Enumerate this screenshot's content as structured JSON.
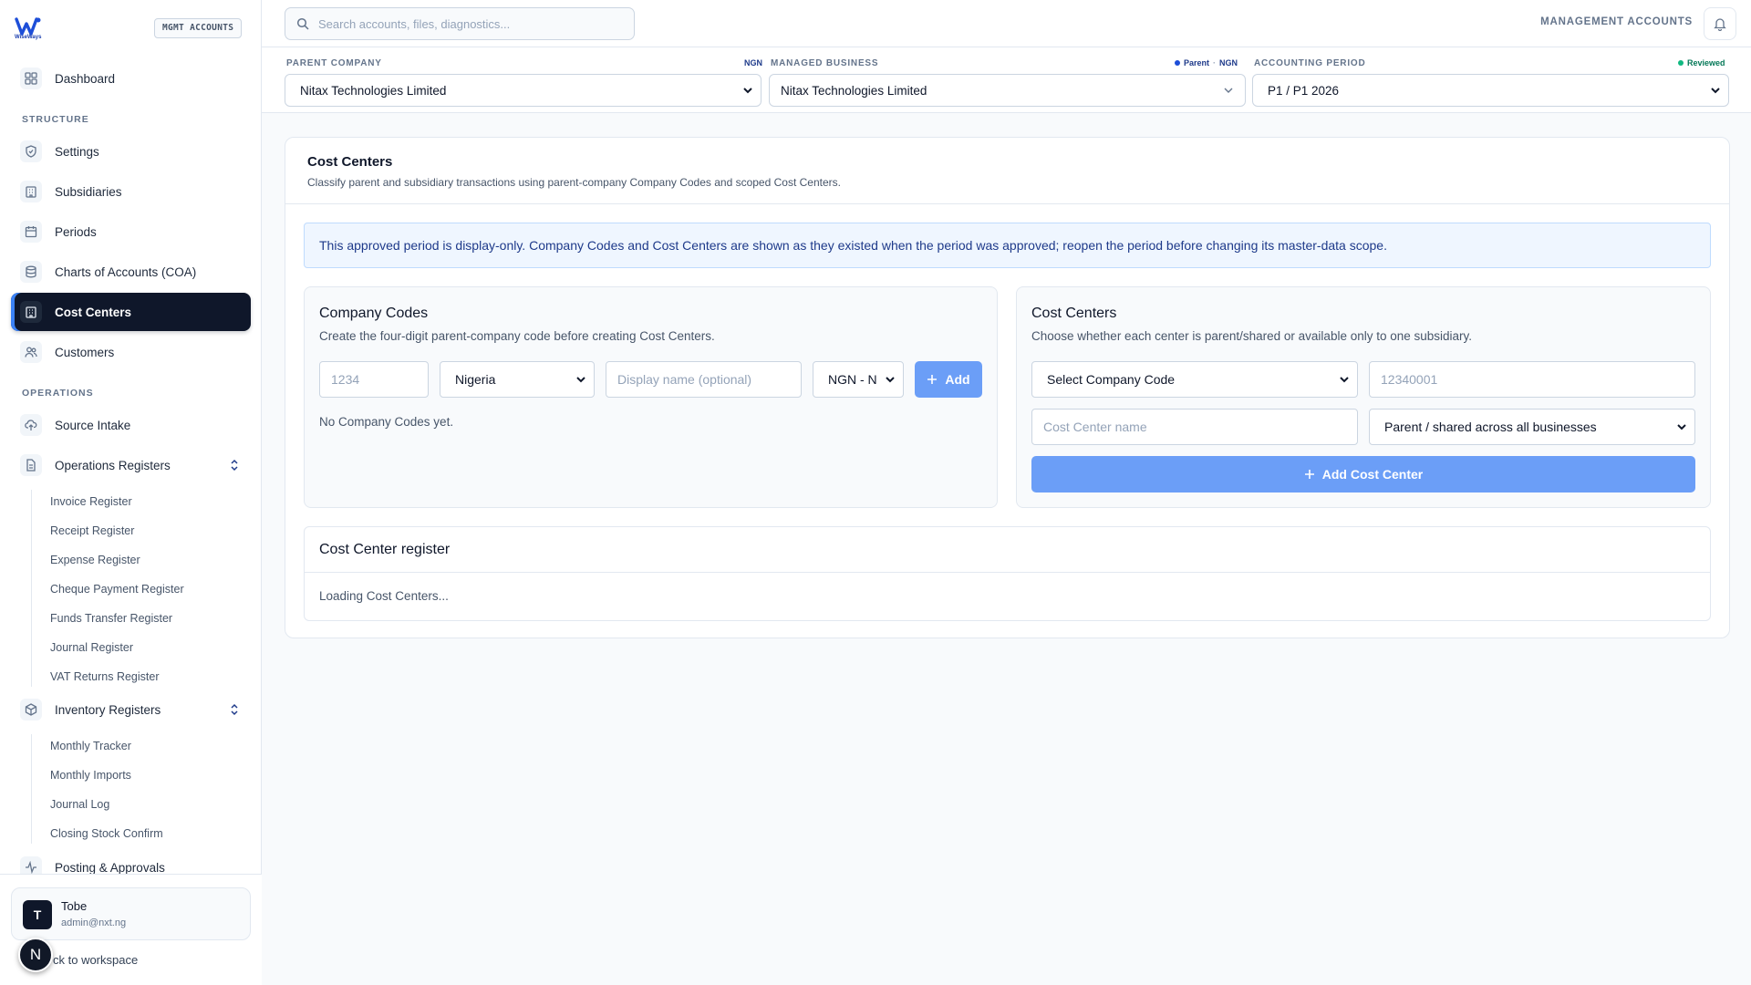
{
  "brand": {
    "badge": "MGMT ACCOUNTS",
    "logo_text": "WiseWays"
  },
  "search": {
    "placeholder": "Search accounts, files, diagnostics..."
  },
  "topbar": {
    "mode_label": "MANAGEMENT ACCOUNTS"
  },
  "sidebar": {
    "dashboard": "Dashboard",
    "structure_label": "STRUCTURE",
    "structure_items": [
      "Settings",
      "Subsidiaries",
      "Periods",
      "Charts of Accounts (COA)",
      "Cost Centers",
      "Customers"
    ],
    "operations_label": "OPERATIONS",
    "source_intake": "Source Intake",
    "operations_registers": {
      "label": "Operations Registers",
      "items": [
        "Invoice Register",
        "Receipt Register",
        "Expense Register",
        "Cheque Payment Register",
        "Funds Transfer Register",
        "Journal Register",
        "VAT Returns Register"
      ]
    },
    "inventory_registers": {
      "label": "Inventory Registers",
      "items": [
        "Monthly Tracker",
        "Monthly Imports",
        "Journal Log",
        "Closing Stock Confirm"
      ]
    },
    "posting": "Posting & Approvals",
    "active_item": "Cost Centers"
  },
  "user": {
    "initial": "T",
    "name": "Tobe",
    "email": "admin@nxt.ng",
    "back_link": "ck to workspace",
    "bubble": "N"
  },
  "context": {
    "parent_company": {
      "label": "PARENT COMPANY",
      "tag": "NGN",
      "value": "Nitax Technologies Limited"
    },
    "managed_business": {
      "label": "MANAGED BUSINESS",
      "tag_parent": "Parent",
      "tag_sep": "·",
      "tag_currency": "NGN",
      "value": "Nitax Technologies Limited"
    },
    "accounting_period": {
      "label": "ACCOUNTING PERIOD",
      "status": "Reviewed",
      "value": "P1 / P1 2026"
    }
  },
  "page": {
    "title": "Cost Centers",
    "subtitle": "Classify parent and subsidiary transactions using parent-company Company Codes and scoped Cost Centers.",
    "banner": "This approved period is display-only. Company Codes and Cost Centers are shown as they existed when the period was approved; reopen the period before changing its master-data scope."
  },
  "company_codes": {
    "title": "Company Codes",
    "subtitle": "Create the four-digit parent-company code before creating Cost Centers.",
    "code_placeholder": "1234",
    "country": "Nigeria",
    "display_name_placeholder": "Display name (optional)",
    "currency": "NGN - N",
    "add_label": "Add",
    "empty": "No Company Codes yet."
  },
  "cost_centers_panel": {
    "title": "Cost Centers",
    "subtitle": "Choose whether each center is parent/shared or available only to one subsidiary.",
    "company_code_select": "Select Company Code",
    "code_placeholder": "12340001",
    "name_placeholder": "Cost Center name",
    "scope_select": "Parent / shared across all businesses",
    "add_label": "Add Cost Center"
  },
  "register": {
    "title": "Cost Center register",
    "loading": "Loading Cost Centers..."
  },
  "colors": {
    "accent": "#3b82f6",
    "active_bg": "#0f172a",
    "button": "#6b9ef7",
    "banner_bg": "#eff6ff",
    "reviewed": "#10b981"
  }
}
